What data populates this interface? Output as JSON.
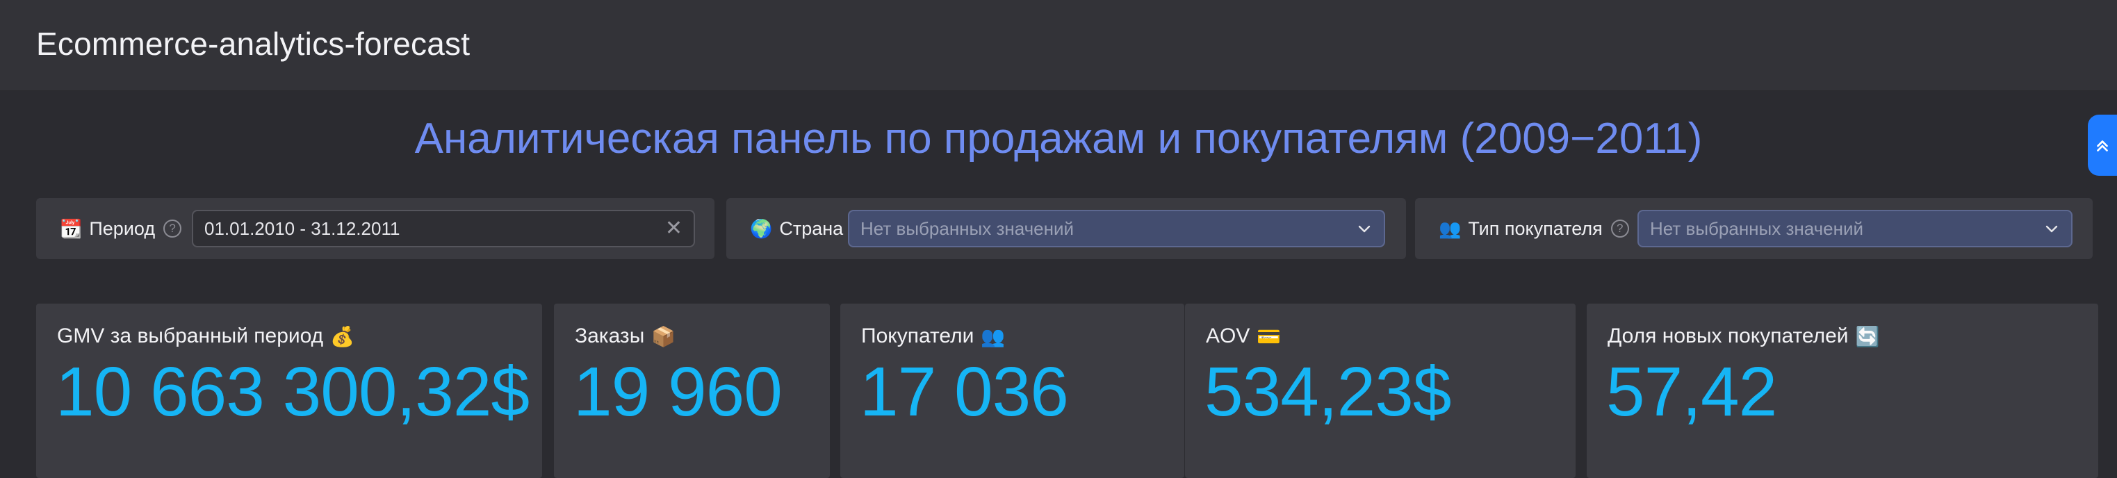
{
  "app": {
    "title": "Ecommerce-analytics-forecast"
  },
  "dashboard": {
    "title": "Аналитическая панель по продажам и покупателям (2009−2011)"
  },
  "filters": {
    "period": {
      "icon": "calendar-icon",
      "label": "Период",
      "value": "01.01.2010 - 31.12.2011"
    },
    "country": {
      "icon": "globe-icon",
      "label": "Страна",
      "placeholder": "Нет выбранных значений"
    },
    "customer_type": {
      "icon": "people-icon",
      "label": "Тип покупателя",
      "placeholder": "Нет выбранных значений"
    }
  },
  "kpis": [
    {
      "label": "GMV за выбранный период",
      "icon": "money-bag-icon",
      "value": "10 663 300,32$"
    },
    {
      "label": "Заказы",
      "icon": "package-icon",
      "value": "19 960"
    },
    {
      "label": "Покупатели",
      "icon": "people-icon",
      "value": "17 036"
    },
    {
      "label": "AOV",
      "icon": "credit-card-icon",
      "value": "534,23$"
    },
    {
      "label": "Доля новых покупателей",
      "icon": "refresh-icon",
      "value": "57,42"
    }
  ],
  "colors": {
    "accent_title": "#6f8cf0",
    "kpi_value": "#16b5f5",
    "button_blue": "#1f7bff"
  }
}
